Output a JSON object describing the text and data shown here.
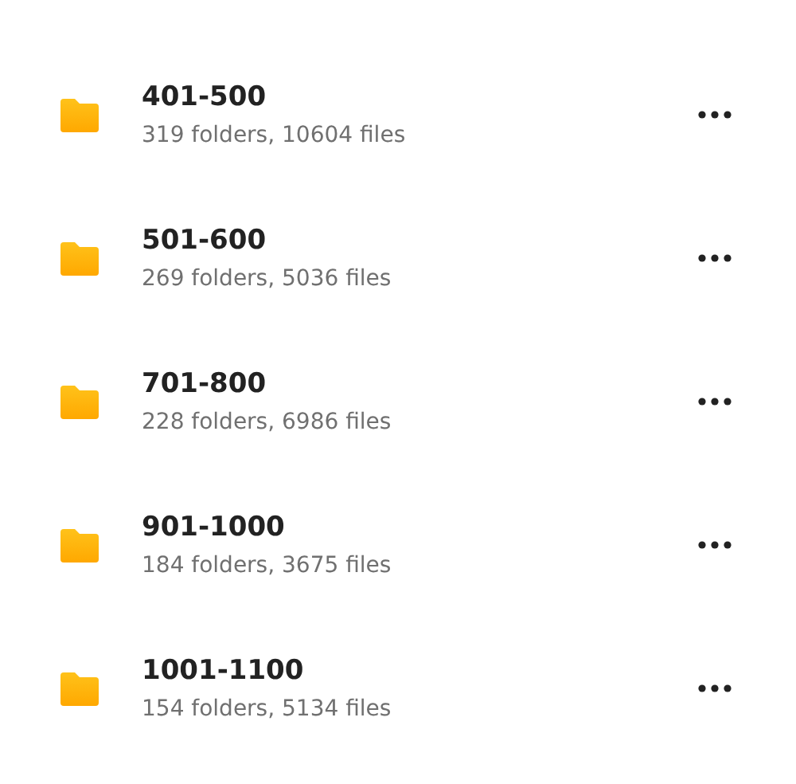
{
  "folders": [
    {
      "name": "401-500",
      "details": "319 folders, 10604 files"
    },
    {
      "name": "501-600",
      "details": "269 folders, 5036 files"
    },
    {
      "name": "701-800",
      "details": "228 folders, 6986 files"
    },
    {
      "name": "901-1000",
      "details": "184 folders, 3675 files"
    },
    {
      "name": "1001-1100",
      "details": "154 folders, 5134 files"
    }
  ]
}
